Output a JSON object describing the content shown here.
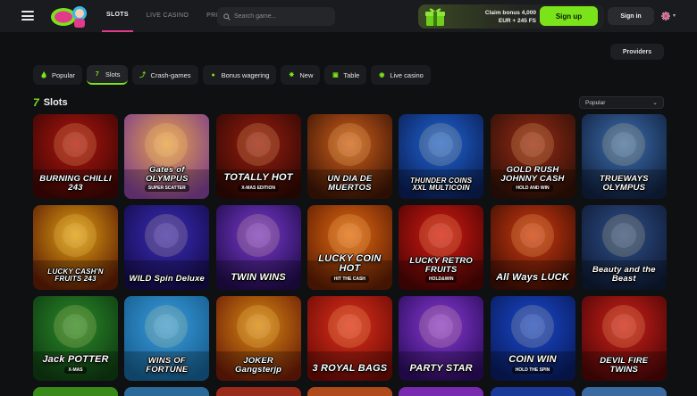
{
  "nav": {
    "items": [
      "SLOTS",
      "LIVE CASINO",
      "PROMO"
    ],
    "active": "SLOTS"
  },
  "search": {
    "placeholder": "Search game..."
  },
  "bonus": {
    "line1": "Claim bonus 4,000",
    "line2": "EUR + 245 FS"
  },
  "auth": {
    "signup": "Sign up",
    "signin": "Sign in"
  },
  "providers_label": "Providers",
  "categories": [
    {
      "label": "Popular",
      "icon": "fire-icon"
    },
    {
      "label": "Slots",
      "icon": "seven-icon"
    },
    {
      "label": "Crash-games",
      "icon": "rocket-icon"
    },
    {
      "label": "Bonus wagering",
      "icon": "coin-icon"
    },
    {
      "label": "New",
      "icon": "star-icon"
    },
    {
      "label": "Table",
      "icon": "cards-icon"
    },
    {
      "label": "Live casino",
      "icon": "live-icon"
    }
  ],
  "section": {
    "title": "Slots"
  },
  "sort": {
    "value": "Popular"
  },
  "games": [
    {
      "title": "BURNING CHILLI 243",
      "sub": "",
      "bg": "#b0150f",
      "bg2": "#3a0604"
    },
    {
      "title": "Gates of OLYMPUS",
      "sub": "SUPER SCATTER",
      "bg": "#e8a24a",
      "bg2": "#7a3c8c"
    },
    {
      "title": "TOTALLY HOT",
      "sub": "X-MAS EDITION",
      "bg": "#9a1d10",
      "bg2": "#2d0803"
    },
    {
      "title": "UN DIA DE MUERTOS",
      "sub": "",
      "bg": "#d2601c",
      "bg2": "#3a1405"
    },
    {
      "title": "THUNDER COINS XXL MULTICOIN",
      "sub": "",
      "bg": "#1f66d8",
      "bg2": "#0b1d52"
    },
    {
      "title": "GOLD RUSH JOHNNY CASH",
      "sub": "HOLD AND WIN",
      "bg": "#9a2a16",
      "bg2": "#2b1006"
    },
    {
      "title": "TRUEWAYS OLYMPUS",
      "sub": "",
      "bg": "#3e6fb0",
      "bg2": "#0f1f3c"
    },
    {
      "title": "LUCKY CASH'N FRUITS 243",
      "sub": "",
      "bg": "#e0a010",
      "bg2": "#5a1a06"
    },
    {
      "title": "WILD Spin Deluxe",
      "sub": "",
      "bg": "#3a2bb8",
      "bg2": "#130c4a"
    },
    {
      "title": "TWIN WINS",
      "sub": "",
      "bg": "#7a3ad0",
      "bg2": "#1f0b48"
    },
    {
      "title": "LUCKY COIN HOT",
      "sub": "HIT THE CASH",
      "bg": "#e56a12",
      "bg2": "#5a1b03"
    },
    {
      "title": "LUCKY RETRO FRUITS",
      "sub": "HOLD&WIN",
      "bg": "#d61a12",
      "bg2": "#4a0404"
    },
    {
      "title": "All Ways LUCK",
      "sub": "",
      "bg": "#d03a10",
      "bg2": "#3d0e04"
    },
    {
      "title": "Beauty and the Beast",
      "sub": "",
      "bg": "#2f4f8a",
      "bg2": "#0e1a33"
    },
    {
      "title": "Jack POTTER",
      "sub": "X-MAS",
      "bg": "#2b8a2a",
      "bg2": "#0e3a10"
    },
    {
      "title": "WINS OF FORTUNE",
      "sub": "",
      "bg": "#3a9ee0",
      "bg2": "#145a8a"
    },
    {
      "title": "JOKER Gangsterjp",
      "sub": "",
      "bg": "#d88a10",
      "bg2": "#6a1a08"
    },
    {
      "title": "3 ROYAL BAGS",
      "sub": "",
      "bg": "#e0301a",
      "bg2": "#6a0a06"
    },
    {
      "title": "PARTY STAR",
      "sub": "",
      "bg": "#8a3ad8",
      "bg2": "#2a0b5a"
    },
    {
      "title": "COIN WIN",
      "sub": "HOLD THE SPIN",
      "bg": "#1a4ad0",
      "bg2": "#081a5a"
    },
    {
      "title": "DEVIL FIRE TWINS",
      "sub": "",
      "bg": "#d0201a",
      "bg2": "#4a0606"
    }
  ],
  "peek_colors": [
    "#3a8a1a",
    "#2a6a9a",
    "#9a2a1a",
    "#b04a1a",
    "#7a2ab0",
    "#1a3a9a",
    "#3a6aa0"
  ]
}
